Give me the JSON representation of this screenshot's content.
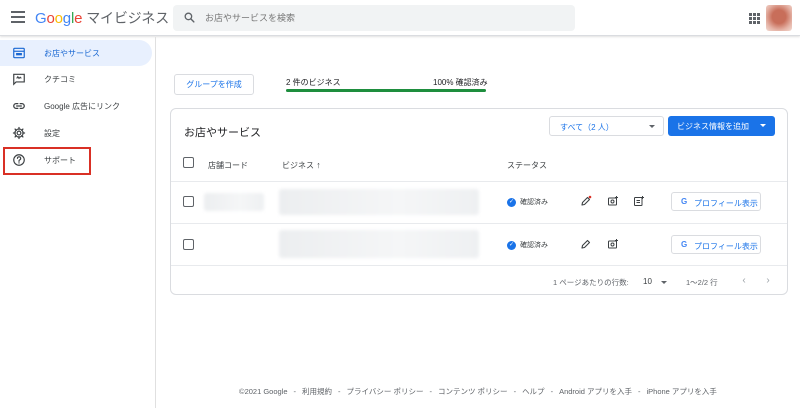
{
  "header": {
    "brand_google": "Google",
    "brand_product": "マイビジネス",
    "search_placeholder": "お店やサービスを検索"
  },
  "sidebar": {
    "items": [
      {
        "label": "お店やサービス",
        "icon": "store-icon",
        "active": true
      },
      {
        "label": "クチコミ",
        "icon": "review-icon",
        "active": false
      },
      {
        "label": "Google 広告にリンク",
        "icon": "link-icon",
        "active": false
      },
      {
        "label": "設定",
        "icon": "gear-icon",
        "active": false
      },
      {
        "label": "サポート",
        "icon": "help-icon",
        "active": false
      }
    ]
  },
  "toolbar": {
    "create_group_label": "グループを作成",
    "business_count": "2 件のビジネス",
    "verified_percent": "100% 確認済み",
    "verified_progress": 1.0
  },
  "card": {
    "title": "お店やサービス",
    "filter_value": "すべて（2 人）",
    "add_button_label": "ビジネス情報を追加",
    "columns": {
      "store_code": "店舗コード",
      "business": "ビジネス",
      "status": "ステータス"
    },
    "rows": [
      {
        "status": "確認済み",
        "profile_label": "プロフィール表示"
      },
      {
        "status": "確認済み",
        "profile_label": "プロフィール表示"
      }
    ],
    "pager": {
      "rows_per_page_label": "1 ページあたりの行数:",
      "rows_per_page_value": "10",
      "range": "1〜2/2 行"
    }
  },
  "footer": {
    "copyright": "©2021 Google",
    "terms": "利用規約",
    "privacy": "プライバシー ポリシー",
    "content_policy": "コンテンツ ポリシー",
    "help": "ヘルプ",
    "android": "Android アプリを入手",
    "iphone": "iPhone アプリを入手"
  },
  "colors": {
    "accent": "#1a73e8",
    "progress": "#1e8e3e",
    "highlight": "#d93025"
  }
}
